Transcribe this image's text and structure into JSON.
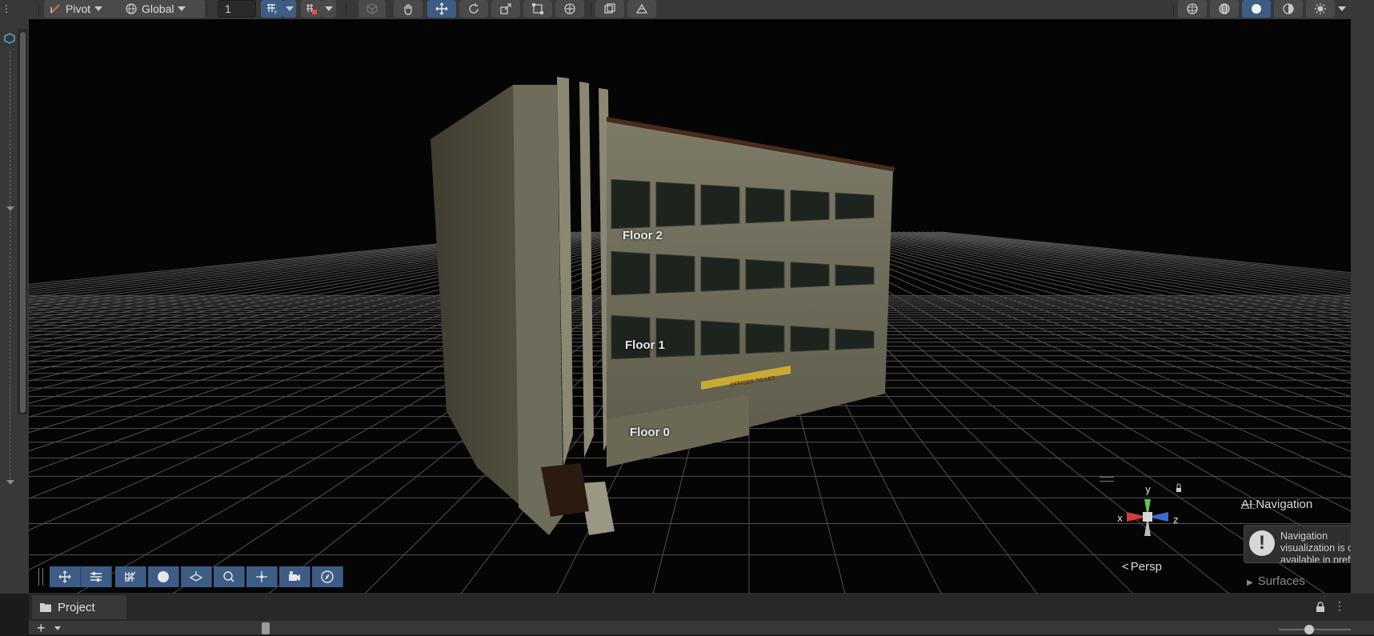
{
  "toolbar": {
    "pivot_label": "Pivot",
    "global_label": "Global",
    "snap_value": "1",
    "tools": [
      "view-tool",
      "move-tool",
      "rotate-tool",
      "scale-tool",
      "rect-tool",
      "transform-tool"
    ]
  },
  "scene": {
    "floor_labels": [
      "Floor 2",
      "Floor 1",
      "Floor 0"
    ],
    "sign_text": "OFFICES TO LET",
    "projection_label": "Persp",
    "gizmo_axes": {
      "x": "x",
      "y": "y",
      "z": "z"
    }
  },
  "ai_navigation": {
    "title": "AI Navigation",
    "message": "Navigation visualization is only available in prefab mode",
    "surfaces_label": "Surfaces"
  },
  "project_panel": {
    "tab_label": "Project"
  },
  "colors": {
    "accent": "#3d5d86",
    "toolbar_bg": "#383838",
    "viewport_bg": "#050505"
  }
}
